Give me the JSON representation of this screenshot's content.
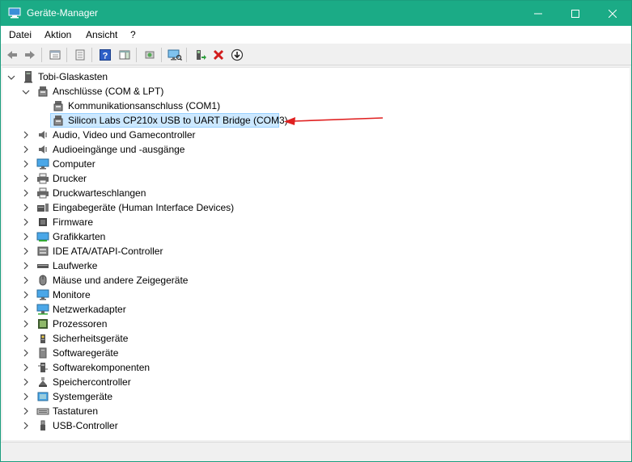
{
  "window": {
    "title": "Geräte-Manager",
    "icon": "device-manager-icon",
    "buttons": {
      "minimize": "minimize-icon",
      "maximize": "maximize-icon",
      "close": "close-icon"
    }
  },
  "menu": [
    {
      "label": "Datei"
    },
    {
      "label": "Aktion"
    },
    {
      "label": "Ansicht"
    },
    {
      "label": "?"
    }
  ],
  "toolbar": [
    {
      "icon": "back-arrow-icon"
    },
    {
      "icon": "forward-arrow-icon"
    },
    {
      "icon": "properties-icon"
    },
    {
      "icon": "show-hidden-icon"
    },
    {
      "icon": "help-icon"
    },
    {
      "icon": "action-pane-icon"
    },
    {
      "icon": "update-driver-icon"
    },
    {
      "icon": "scan-hardware-icon"
    },
    {
      "icon": "add-legacy-icon"
    },
    {
      "icon": "uninstall-x-icon"
    },
    {
      "icon": "download-icon"
    }
  ],
  "tree": {
    "root": {
      "label": "Tobi-Glaskasten",
      "icon": "computer-icon",
      "expanded": true
    },
    "ports": {
      "label": "Anschlüsse (COM & LPT)",
      "icon": "port-icon",
      "expanded": true,
      "children": [
        {
          "label": "Kommunikationsanschluss (COM1)",
          "icon": "port-icon"
        },
        {
          "label": "Silicon Labs CP210x USB to UART Bridge (COM3)",
          "icon": "port-icon",
          "selected": true
        }
      ]
    },
    "categories": [
      {
        "label": "Audio, Video und Gamecontroller",
        "icon": "speaker-icon"
      },
      {
        "label": "Audioeingänge und -ausgänge",
        "icon": "speaker-icon"
      },
      {
        "label": "Computer",
        "icon": "monitor-icon"
      },
      {
        "label": "Drucker",
        "icon": "printer-icon"
      },
      {
        "label": "Druckwarteschlangen",
        "icon": "printer-icon"
      },
      {
        "label": "Eingabegeräte (Human Interface Devices)",
        "icon": "hid-icon"
      },
      {
        "label": "Firmware",
        "icon": "chip-icon"
      },
      {
        "label": "Grafikkarten",
        "icon": "graphics-card-icon"
      },
      {
        "label": "IDE ATA/ATAPI-Controller",
        "icon": "ide-icon"
      },
      {
        "label": "Laufwerke",
        "icon": "drive-icon"
      },
      {
        "label": "Mäuse und andere Zeigegeräte",
        "icon": "mouse-icon"
      },
      {
        "label": "Monitore",
        "icon": "monitor-icon"
      },
      {
        "label": "Netzwerkadapter",
        "icon": "network-icon"
      },
      {
        "label": "Prozessoren",
        "icon": "cpu-icon"
      },
      {
        "label": "Sicherheitsgeräte",
        "icon": "security-icon"
      },
      {
        "label": "Softwaregeräte",
        "icon": "software-device-icon"
      },
      {
        "label": "Softwarekomponenten",
        "icon": "software-component-icon"
      },
      {
        "label": "Speichercontroller",
        "icon": "storage-controller-icon"
      },
      {
        "label": "Systemgeräte",
        "icon": "system-device-icon"
      },
      {
        "label": "Tastaturen",
        "icon": "keyboard-icon"
      },
      {
        "label": "USB-Controller",
        "icon": "usb-icon"
      }
    ]
  },
  "colors": {
    "titlebar": "#1bab86",
    "selection": "#cce8ff",
    "annotation_arrow": "#e02020"
  }
}
